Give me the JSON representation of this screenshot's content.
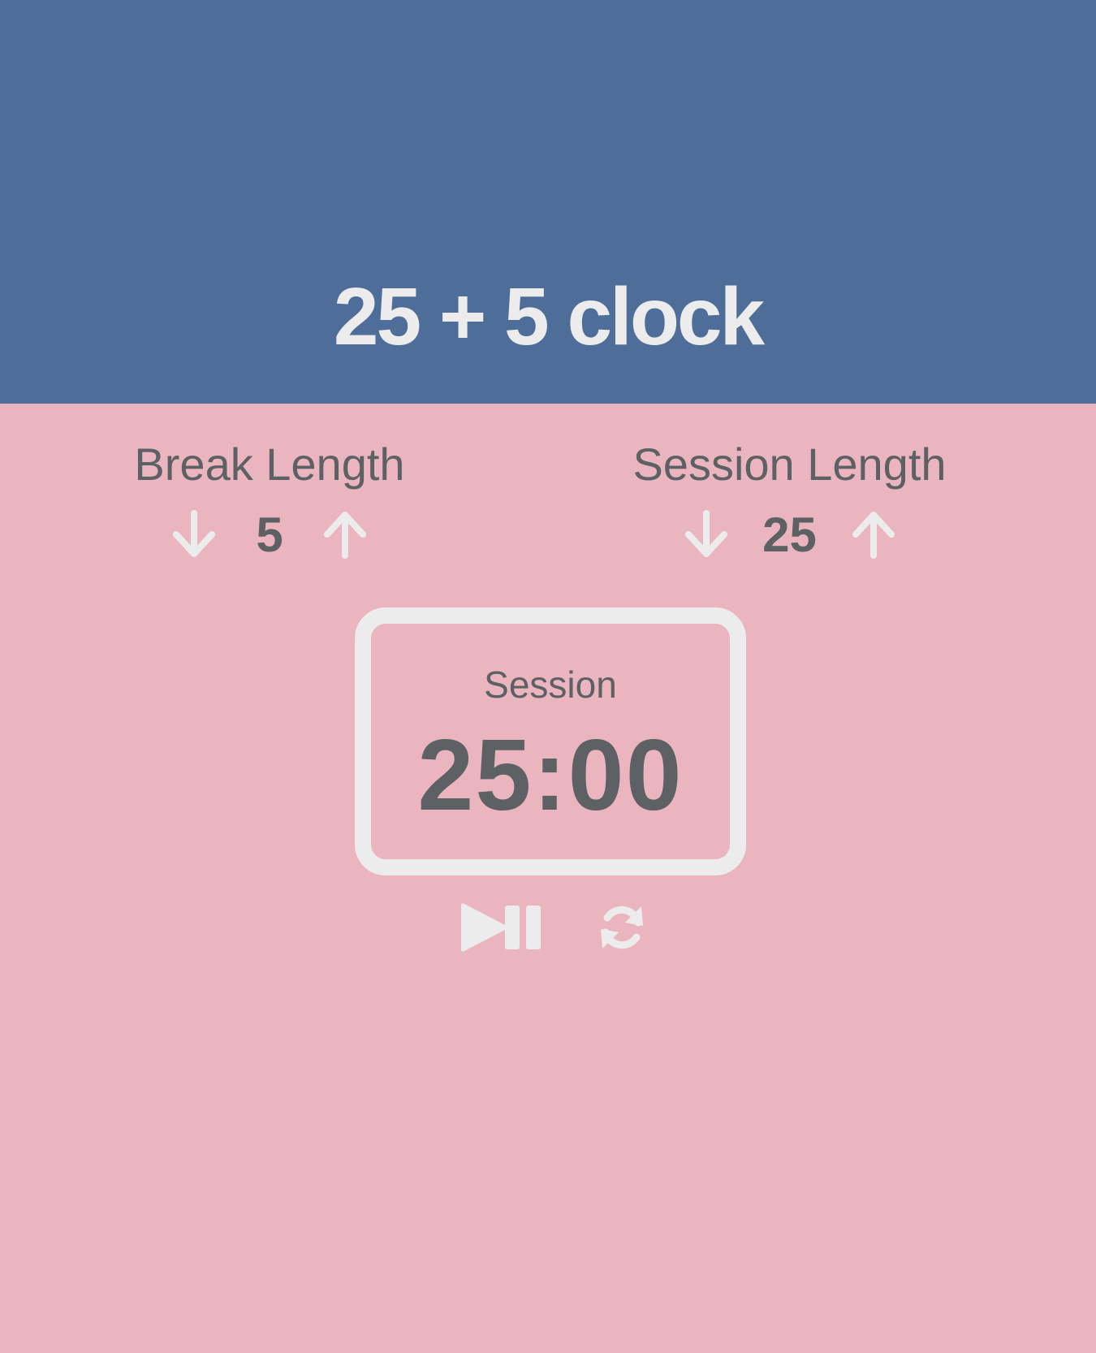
{
  "header": {
    "title": "25 + 5 clock"
  },
  "break_control": {
    "label": "Break Length",
    "value": "5",
    "decrement_icon": "arrow-down-icon",
    "increment_icon": "arrow-up-icon"
  },
  "session_control": {
    "label": "Session Length",
    "value": "25",
    "decrement_icon": "arrow-down-icon",
    "increment_icon": "arrow-up-icon"
  },
  "timer": {
    "label": "Session",
    "time_left": "25:00"
  },
  "controls": {
    "start_stop_icon": "play-pause-icon",
    "reset_icon": "refresh-icon"
  },
  "colors": {
    "header_background": "#4e6e99",
    "body_background": "#ebb5c0",
    "light_text": "#ececec",
    "dark_text": "#5e6163"
  }
}
